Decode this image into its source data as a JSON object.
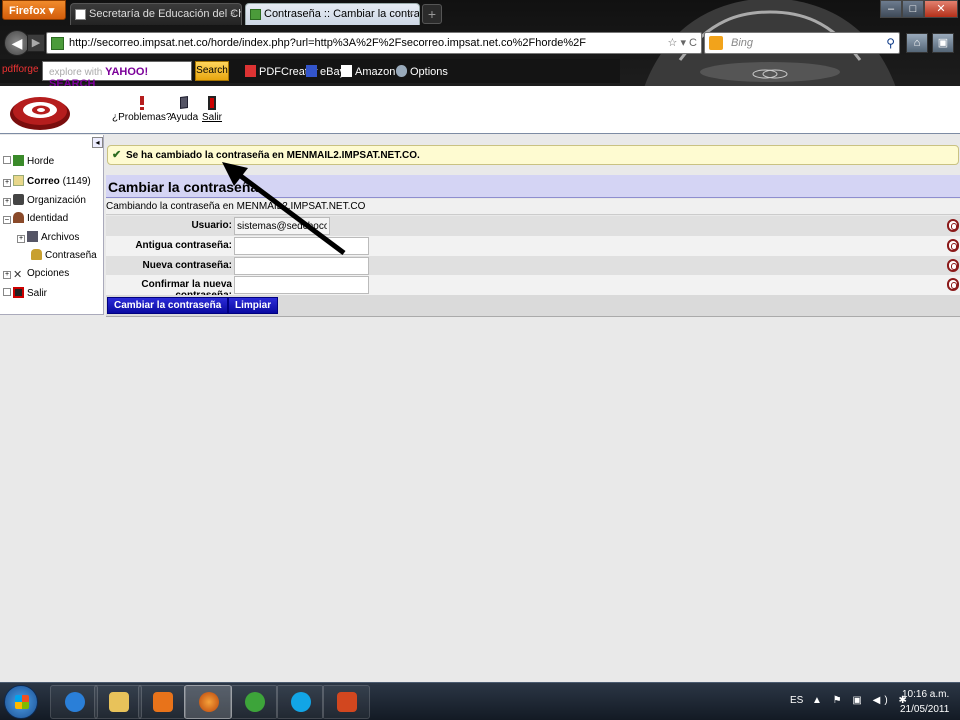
{
  "browser": {
    "firefox_label": "Firefox",
    "tabs": [
      {
        "label": "Secretaría de Educación del Chocó",
        "close": "×"
      },
      {
        "label": "Contraseña :: Cambiar la contraseña",
        "close": "×"
      }
    ],
    "new_tab": "+",
    "url": "http://secorreo.impsat.net.co/horde/index.php?url=http%3A%2F%2Fsecorreo.impsat.net.co%2Fhorde%2F",
    "search_placeholder": "Bing",
    "toolbar": {
      "pdfforge": "pdfforge",
      "yahoo_prefix": "explore with",
      "yahoo_brand": "YAHOO! SEARCH",
      "search_btn": "Search",
      "pdfcreator": "PDFCreator",
      "ebay": "eBay",
      "amazon": "Amazon",
      "options": "Options"
    }
  },
  "header": {
    "links": [
      {
        "label": "¿Problemas?"
      },
      {
        "label": "Ayuda"
      },
      {
        "label": "Salir"
      }
    ]
  },
  "sidebar": {
    "items": [
      {
        "label": "Horde"
      },
      {
        "label": "Correo",
        "count": "(1149)"
      },
      {
        "label": "Organización"
      },
      {
        "label": "Identidad"
      },
      {
        "label": "Archivos"
      },
      {
        "label": "Contraseña"
      },
      {
        "label": "Opciones"
      },
      {
        "label": "Salir"
      }
    ]
  },
  "notification": "Se ha cambiado la contraseña en MENMAIL2.IMPSAT.NET.CO.",
  "form": {
    "title": "Cambiar la contraseña",
    "subtitle": "Cambiando la contraseña en MENMAIL2.IMPSAT.NET.CO",
    "fields": [
      {
        "label": "Usuario:",
        "value": "sistemas@sedchoco.g"
      },
      {
        "label": "Antigua contraseña:",
        "value": ""
      },
      {
        "label": "Nueva contraseña:",
        "value": ""
      },
      {
        "label": "Confirmar la nueva contraseña:",
        "value": ""
      }
    ],
    "submit_label": "Cambiar la contraseña",
    "reset_label": "Limpiar"
  },
  "taskbar": {
    "lang": "ES",
    "time": "10:16 a.m.",
    "date": "21/05/2011"
  },
  "colors": {
    "notify_bg": "#fefbd1",
    "form_head_bg": "#d4d4f4",
    "button_blue": "#0a0aa0"
  }
}
